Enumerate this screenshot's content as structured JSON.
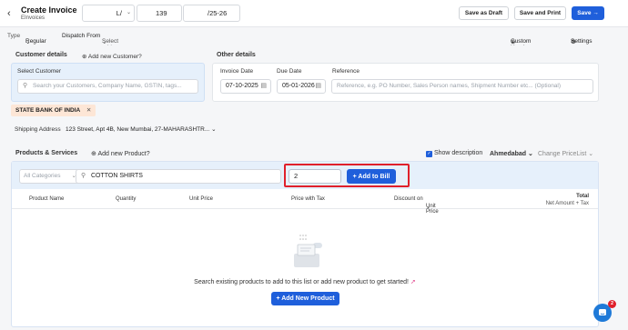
{
  "header": {
    "title": "Create Invoice",
    "subtitle": "EInvoices",
    "invoice_prefix": "L/",
    "invoice_number": "139",
    "invoice_suffix": "/25-26",
    "save_draft": "Save as Draft",
    "save_print": "Save and Print",
    "save": "Save"
  },
  "toolbar": {
    "type_label": "Type",
    "type_value": "Regular",
    "dispatch_label": "Dispatch From",
    "dispatch_value": "Select address",
    "custom_headers": "Custom Headers",
    "settings": "Settings"
  },
  "customer": {
    "section_title": "Customer details",
    "add_new": "Add new Customer?",
    "box_label": "Select Customer",
    "search_placeholder": "Search your Customers, Company Name, GSTIN, tags...",
    "selected_chip": "STATE BANK OF INDIA",
    "shipping_label": "Shipping Address",
    "shipping_value": "123 Street, Apt 4B, New Mumbai, 27-MAHARASHTR..."
  },
  "other": {
    "section_title": "Other details",
    "invoice_date_label": "Invoice Date",
    "invoice_date": "07-10-2025",
    "due_date_label": "Due Date",
    "due_date": "05-01-2026",
    "reference_label": "Reference",
    "reference_placeholder": "Reference, e.g. PO Number, Sales Person names, Shipment Number etc... (Optional)"
  },
  "products": {
    "section_title": "Products & Services",
    "add_new": "Add new Product?",
    "show_description": "Show description",
    "warehouse": "Ahmedabad",
    "price_list": "Change PriceList",
    "category_placeholder": "All Categories",
    "search_value": "COTTON SHIRTS",
    "quantity_value": "2",
    "add_to_bill": "+ Add to Bill",
    "columns": {
      "product_name": "Product Name",
      "quantity": "Quantity",
      "unit_price": "Unit Price",
      "price_with_tax": "Price with Tax",
      "discount_on": "Discount on",
      "discount_unit": "Unit Price",
      "total": "Total",
      "net_amount": "Net Amount + Tax"
    },
    "empty_message": "Search existing products to add to this list or add new product to get started!",
    "add_new_product": "+ Add New Product"
  },
  "chat": {
    "badge": "2"
  },
  "colors": {
    "accent": "#1f5fdb",
    "highlight": "#e0202b",
    "panel_blue": "#e6f0fb",
    "chip": "#fde6d6"
  }
}
